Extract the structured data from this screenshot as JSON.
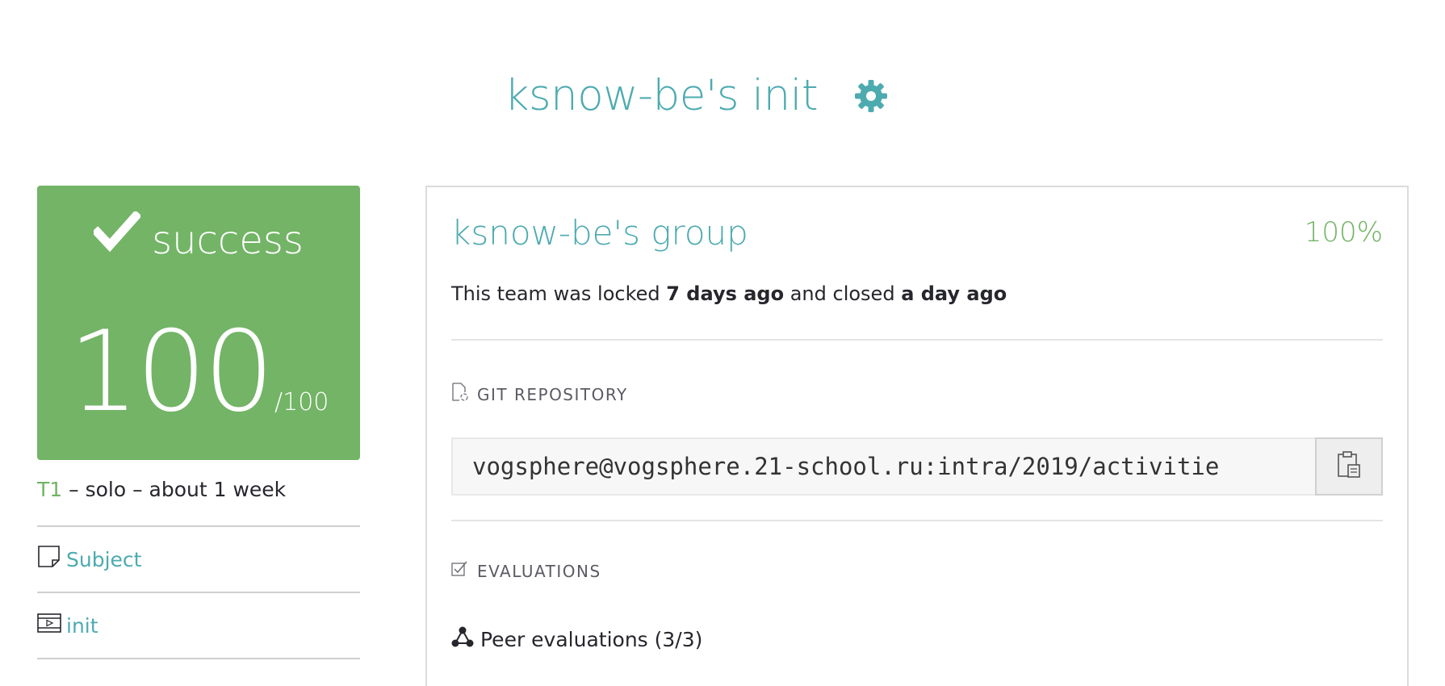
{
  "header": {
    "title": "ksnow-be's init",
    "settings_icon": "gear-icon"
  },
  "status": {
    "label": "success",
    "score": "100",
    "max": "/100",
    "color": "#73b466"
  },
  "meta": {
    "tier": "T1",
    "rest": " – solo – about 1 week"
  },
  "sidebar": {
    "links": [
      {
        "label": "Subject",
        "icon": "document-icon"
      },
      {
        "label": "init",
        "icon": "video-icon"
      }
    ]
  },
  "team": {
    "name": "ksnow-be's group",
    "score": "100%",
    "lock_prefix": "This team was locked ",
    "locked_when": "7 days ago",
    "lock_middle": " and closed ",
    "closed_when": "a day ago"
  },
  "git": {
    "section_title": "GIT REPOSITORY",
    "repo_url": "vogsphere@vogsphere.21-school.ru:intra/2019/activitie"
  },
  "evaluations": {
    "section_title": "EVALUATIONS",
    "peer_label": "Peer evaluations (3/3)"
  },
  "colors": {
    "accent": "#4dabb0",
    "success": "#73b466"
  }
}
